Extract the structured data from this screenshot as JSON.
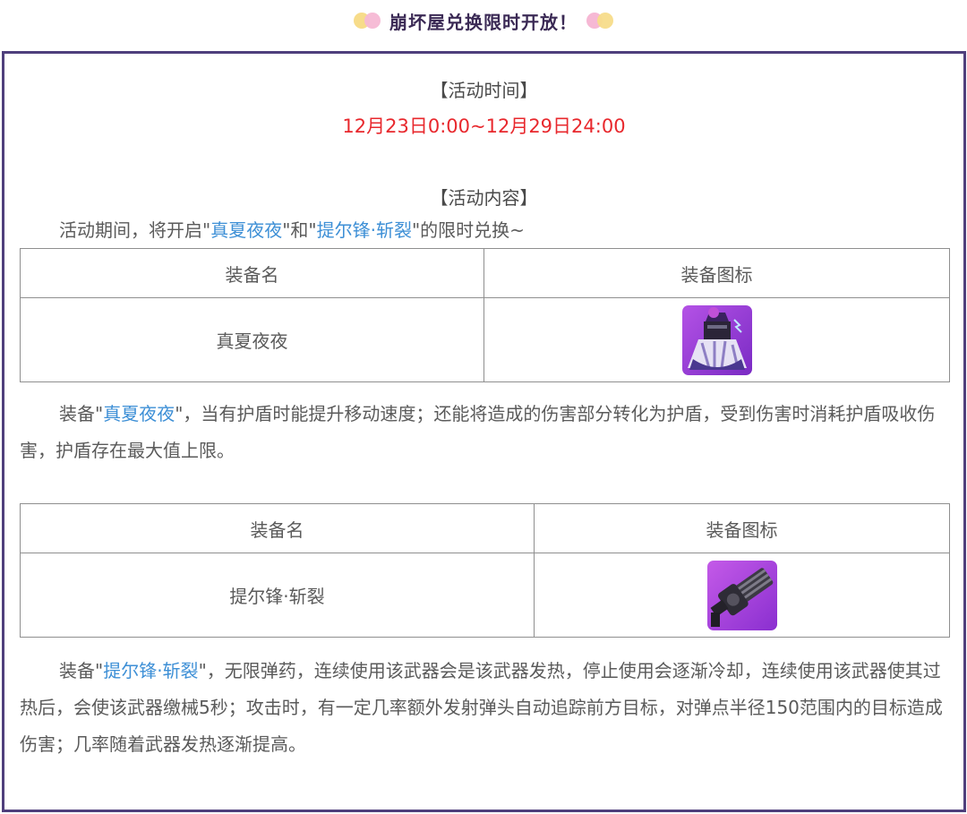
{
  "header": {
    "title": "崩坏屋兑换限时开放！"
  },
  "event_time": {
    "title": "【活动时间】",
    "range": "12月23日0:00~12月29日24:00"
  },
  "event_content": {
    "title": "【活动内容】",
    "intro_prefix": "活动期间，将开启\"",
    "intro_link1": "真夏夜夜",
    "intro_middle": "\"和\"",
    "intro_link2": "提尔锋·斩裂",
    "intro_suffix": "\"的限时兑换~"
  },
  "tables": [
    {
      "headers": [
        "装备名",
        "装备图标"
      ],
      "name": "真夏夜夜",
      "icon": "dress-armor-icon"
    },
    {
      "headers": [
        "装备名",
        "装备图标"
      ],
      "name": "提尔锋·斩裂",
      "icon": "gatling-gun-icon"
    }
  ],
  "descriptions": [
    {
      "prefix": "装备\"",
      "link": "真夏夜夜",
      "text": "\"，当有护盾时能提升移动速度；还能将造成的伤害部分转化为护盾，受到伤害时消耗护盾吸收伤害，护盾存在最大值上限。"
    },
    {
      "prefix": "装备\"",
      "link": "提尔锋·斩裂",
      "text": "\"，无限弹药，连续使用该武器会是该武器发热，停止使用会逐渐冷却，连续使用该武器使其过热后，会使该武器缴械5秒；攻击时，有一定几率额外发射弹头自动追踪前方目标，对弹点半径150范围内的目标造成伤害；几率随着武器发热逐渐提高。"
    }
  ],
  "colors": {
    "frame": "#4f3f7c",
    "date": "#e8282d",
    "link": "#3d8fd6",
    "title": "#3b2a55"
  }
}
